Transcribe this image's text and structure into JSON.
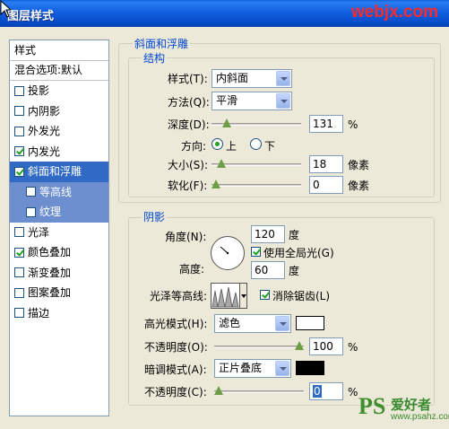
{
  "window": {
    "title": "图层样式",
    "brand": "webjx.com"
  },
  "sidebar": {
    "header": "样式",
    "blend_options": "混合选项:默认",
    "items": [
      {
        "label": "投影",
        "checked": false
      },
      {
        "label": "内阴影",
        "checked": false
      },
      {
        "label": "外发光",
        "checked": false
      },
      {
        "label": "内发光",
        "checked": true
      },
      {
        "label": "斜面和浮雕",
        "checked": true,
        "selected": true
      },
      {
        "label": "等高线",
        "checked": false,
        "sub": true
      },
      {
        "label": "纹理",
        "checked": false,
        "sub": true
      },
      {
        "label": "光泽",
        "checked": false
      },
      {
        "label": "颜色叠加",
        "checked": true
      },
      {
        "label": "渐变叠加",
        "checked": false
      },
      {
        "label": "图案叠加",
        "checked": false
      },
      {
        "label": "描边",
        "checked": false
      }
    ]
  },
  "bevel": {
    "section_title": "斜面和浮雕",
    "structure_title": "结构",
    "style_label": "样式(T):",
    "style_value": "内斜面",
    "technique_label": "方法(Q):",
    "technique_value": "平滑",
    "depth_label": "深度(D):",
    "depth_value": "131",
    "depth_unit": "%",
    "depth_level": 0.13,
    "direction_label": "方向:",
    "direction_up": "上",
    "direction_down": "下",
    "size_label": "大小(S):",
    "size_value": "18",
    "size_unit": "像素",
    "size_level": 0.07,
    "soften_label": "软化(F):",
    "soften_value": "0",
    "soften_unit": "像素",
    "soften_level": 0.0
  },
  "shading": {
    "title": "阴影",
    "angle_label": "角度(N):",
    "angle_value": "120",
    "angle_unit": "度",
    "global_light_label": "使用全局光(G)",
    "global_light_checked": true,
    "altitude_label": "高度:",
    "altitude_value": "60",
    "altitude_unit": "度",
    "gloss_contour_label": "光泽等高线:",
    "antialias_label": "消除锯齿(L)",
    "antialias_checked": true,
    "highlight_mode_label": "高光模式(H):",
    "highlight_mode_value": "滤色",
    "highlight_color": "#ffffff",
    "highlight_opacity_label": "不透明度(O):",
    "highlight_opacity_value": "100",
    "highlight_opacity_unit": "%",
    "highlight_opacity_level": 1.0,
    "shadow_mode_label": "暗调模式(A):",
    "shadow_mode_value": "正片叠底",
    "shadow_color": "#000000",
    "shadow_opacity_label": "不透明度(C):",
    "shadow_opacity_value": "0",
    "shadow_opacity_unit": "%",
    "shadow_opacity_level": 0.0
  },
  "watermark": {
    "ps": "PS",
    "cn": "爱好者",
    "url": "www.psahz.com"
  }
}
